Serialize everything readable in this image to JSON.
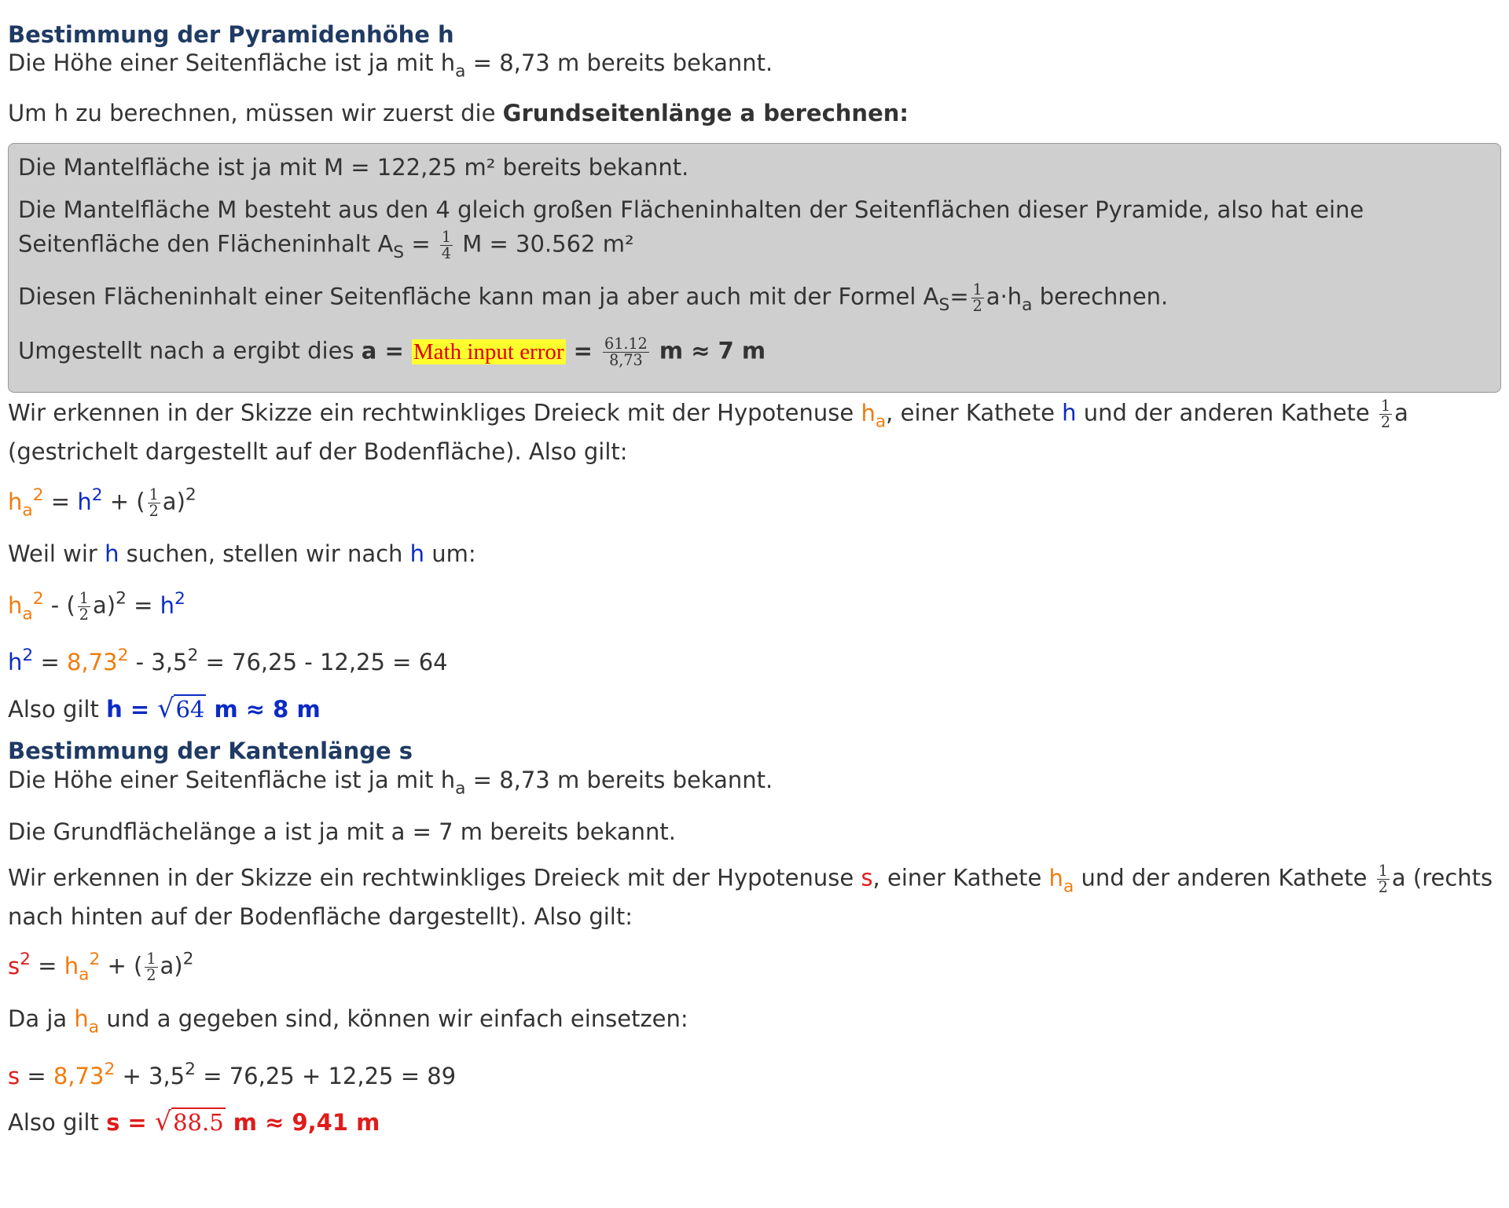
{
  "section1": {
    "heading": "Bestimmung der Pyramidenhöhe h",
    "p1": {
      "a": "Die Höhe einer Seitenfläche ist ja mit h",
      "sub": "a",
      "b": " = 8,73 m bereits bekannt."
    },
    "p2": {
      "a": "Um h zu berechnen, müssen wir zuerst die ",
      "bold": "Grundseitenlänge a berechnen:"
    },
    "box": {
      "l1": "Die Mantelfläche ist ja mit M = 122,25 m² bereits bekannt.",
      "l2": "Die Mantelfläche M besteht aus den 4 gleich großen Flächeninhalten der Seitenflächen dieser Pyramide, also hat eine",
      "l3": {
        "a": "Seitenfläche den Flächeninhalt A",
        "sub": "S",
        "b": " = ",
        "num": "1",
        "den": "4",
        "c": " M = 30.562 m²"
      },
      "l4": {
        "a": "Diesen Flächeninhalt einer Seitenfläche kann man ja aber auch mit der Formel A",
        "sub": "S",
        "eq": "=",
        "num": "1",
        "den": "2",
        "c": "a·h",
        "sub2": "a",
        "d": " berechnen."
      },
      "l5": {
        "a": "Umgestellt nach a ergibt dies ",
        "bold": "a = ",
        "err": "Math input error",
        "eq": " = ",
        "num": "61.12",
        "den": "8,73",
        "res": " m ≈ 7 m"
      }
    },
    "p3": {
      "a": "Wir erkennen in der Skizze ein rechtwinkliges Dreieck mit der Hypotenuse ",
      "h": "h",
      "hsub": "a",
      "b": ", einer Kathete ",
      "k": "h",
      "c": " und der anderen Kathete ",
      "num": "1",
      "den": "2",
      "d": "a"
    },
    "p3b": "(gestrichelt dargestellt auf der Bodenfläche). Also gilt:",
    "eq1": {
      "h": "h",
      "hsub": "a",
      "hsup": "2",
      "a": " = ",
      "k": "h",
      "ksup": "2",
      "b": " + (",
      "num": "1",
      "den": "2",
      "c": "a)",
      "csup": "2"
    },
    "p4": {
      "a": "Weil wir ",
      "h1": "h",
      "b": " suchen, stellen wir nach ",
      "h2": "h",
      "c": " um:"
    },
    "eq2": {
      "h": "h",
      "hsub": "a",
      "hsup": "2",
      "a": " - (",
      "num": "1",
      "den": "2",
      "b": "a)",
      "bsup": "2",
      "c": " = ",
      "k": "h",
      "ksup": "2"
    },
    "eq3": {
      "k": "h",
      "ksup": "2",
      "a": " = ",
      "v": "8,73",
      "vsup": "2",
      "b": " - 3,5",
      "bsup": "2",
      "c": " = 76,25 - 12,25 = 64"
    },
    "res": {
      "a": "Also gilt ",
      "bold": "h = ",
      "rad": "√",
      "root": "64",
      "tail": " m ≈ 8 m"
    }
  },
  "section2": {
    "heading": "Bestimmung der Kantenlänge s",
    "p1": {
      "a": "Die Höhe einer Seitenfläche ist ja mit h",
      "sub": "a",
      "b": " = 8,73 m bereits bekannt."
    },
    "p2": "Die Grundflächelänge a ist ja mit a = 7 m bereits bekannt.",
    "p3": {
      "a": "Wir erkennen in der Skizze ein rechtwinkliges Dreieck mit der Hypotenuse ",
      "s": "s",
      "b": ", einer Kathete ",
      "h": "h",
      "hsub": "a",
      "c": " und der anderen Kathete ",
      "num": "1",
      "den": "2",
      "d": "a (rechts"
    },
    "p3b": "nach hinten auf der Bodenfläche dargestellt). Also gilt:",
    "eq1": {
      "s": "s",
      "ssup": "2",
      "a": " = ",
      "h": "h",
      "hsub": "a",
      "hsup": "2",
      "b": " + (",
      "num": "1",
      "den": "2",
      "c": "a)",
      "csup": "2"
    },
    "p4": {
      "a": "Da ja ",
      "h": "h",
      "hsub": "a",
      "b": " und a gegeben sind, können wir einfach einsetzen:"
    },
    "eq2": {
      "s": "s",
      "a": " = ",
      "v": "8,73",
      "vsup": "2",
      "b": " + 3,5",
      "bsup": "2",
      "c": " = 76,25 + 12,25 = 89"
    },
    "res": {
      "a": "Also gilt ",
      "bold": "s = ",
      "rad": "√",
      "root": "88.5",
      "tail": " m ≈ 9,41 m"
    }
  }
}
